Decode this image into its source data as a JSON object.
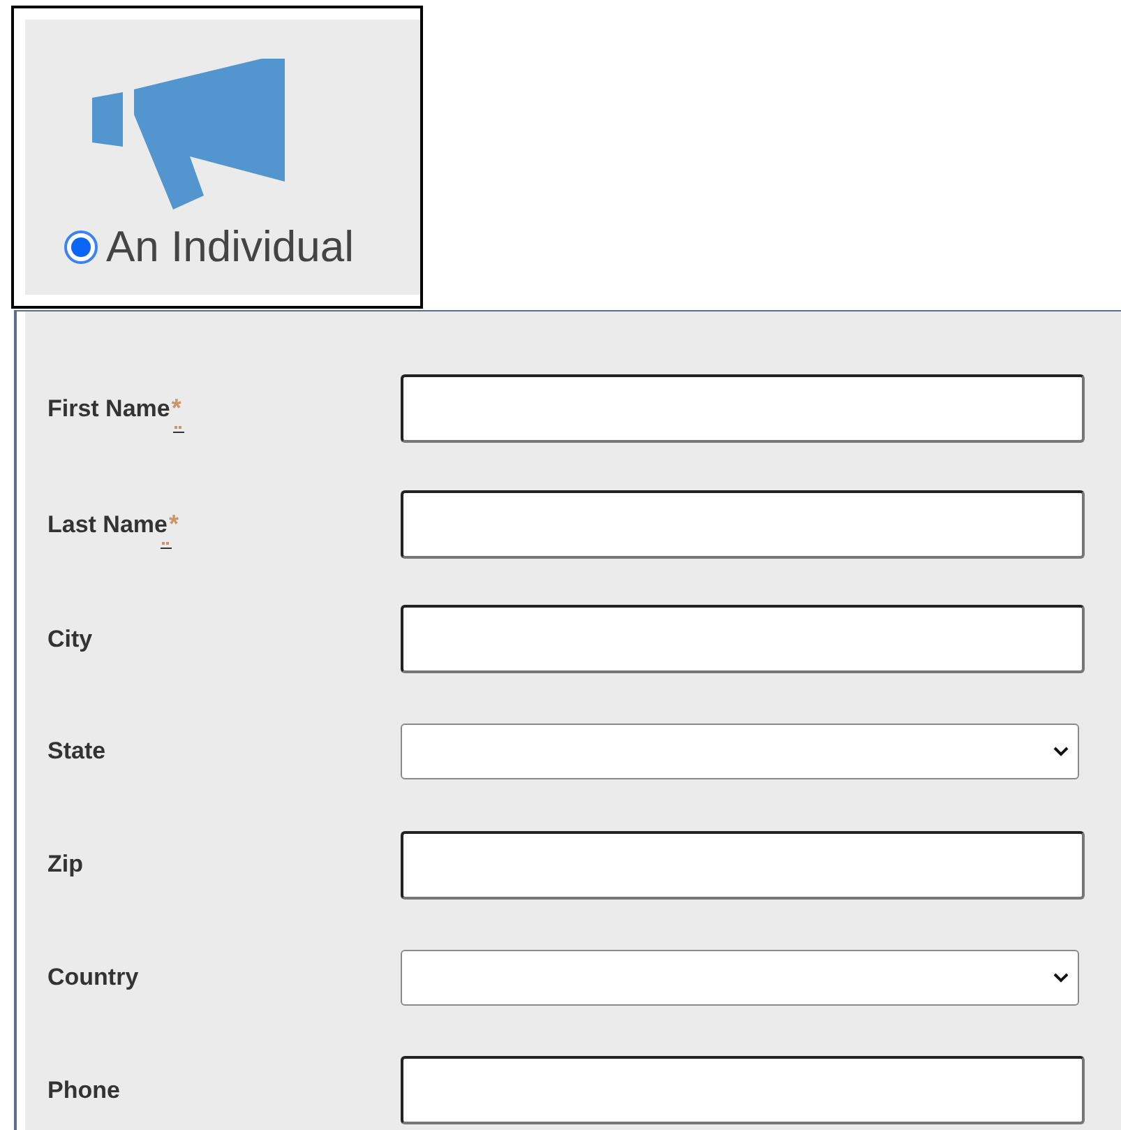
{
  "option": {
    "label": "An Individual",
    "selected": true
  },
  "fields": [
    {
      "label": "First Name",
      "required_mark": "*",
      "kind": "text"
    },
    {
      "label": "Last Name",
      "required_mark": "*",
      "kind": "text"
    },
    {
      "label": "City",
      "kind": "text"
    },
    {
      "label": "State",
      "kind": "select"
    },
    {
      "label": "Zip",
      "kind": "text"
    },
    {
      "label": "Country",
      "kind": "select"
    },
    {
      "label": "Phone",
      "kind": "text"
    }
  ]
}
